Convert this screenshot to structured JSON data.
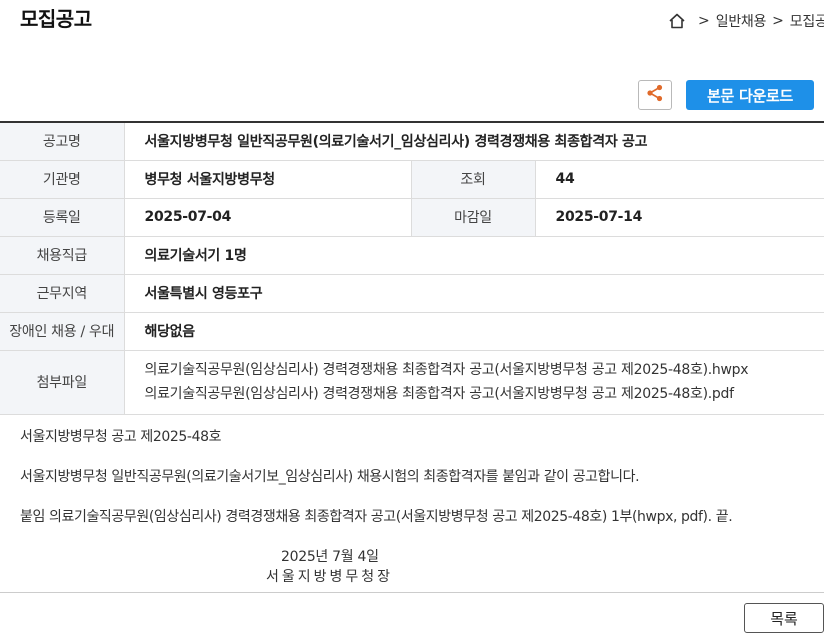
{
  "page": {
    "title": "모집공고"
  },
  "breadcrumb": {
    "home_icon": "home-icon",
    "items": [
      "일반채용",
      "모집공고"
    ],
    "separator": ">"
  },
  "toolbar": {
    "share_icon": "share-icon",
    "download_label": "본문 다운로드"
  },
  "info": {
    "title_label": "공고명",
    "title_value": "서울지방병무청 일반직공무원(의료기술서기_임상심리사) 경력경쟁채용 최종합격자 공고",
    "agency_label": "기관명",
    "agency_value": "병무청 서울지방병무청",
    "views_label": "조회",
    "views_value": "44",
    "reg_label": "등록일",
    "reg_value": "2025-07-04",
    "deadline_label": "마감일",
    "deadline_value": "2025-07-14",
    "grade_label": "채용직급",
    "grade_value": "의료기술서기 1명",
    "region_label": "근무지역",
    "region_value": "서울특별시 영등포구",
    "disability_label": "장애인 채용 / 우대",
    "disability_value": "해당없음",
    "attach_label": "첨부파일",
    "attachments": [
      "의료기술직공무원(임상심리사) 경력경쟁채용 최종합격자 공고(서울지방병무청 공고 제2025-48호).hwpx",
      "의료기술직공무원(임상심리사) 경력경쟁채용 최종합격자 공고(서울지방병무청 공고 제2025-48호).pdf"
    ]
  },
  "body": {
    "line1": "서울지방병무청 공고 제2025-48호",
    "line2": "서울지방병무청 일반직공무원(의료기술서기보_임상심리사) 채용시험의 최종합격자를 붙임과 같이 공고합니다.",
    "line3": "붙임  의료기술직공무원(임상심리사) 경력경쟁채용 최종합격자 공고(서울지방병무청 공고 제2025-48호) 1부(hwpx, pdf).  끝.",
    "date": "2025년 7월 4일",
    "signer": "서울지방병무청장"
  },
  "footer": {
    "list_label": "목록"
  },
  "colors": {
    "accent": "#1e90e8",
    "label_bg": "#f3f5f8",
    "share_icon": "#e06a2a"
  }
}
